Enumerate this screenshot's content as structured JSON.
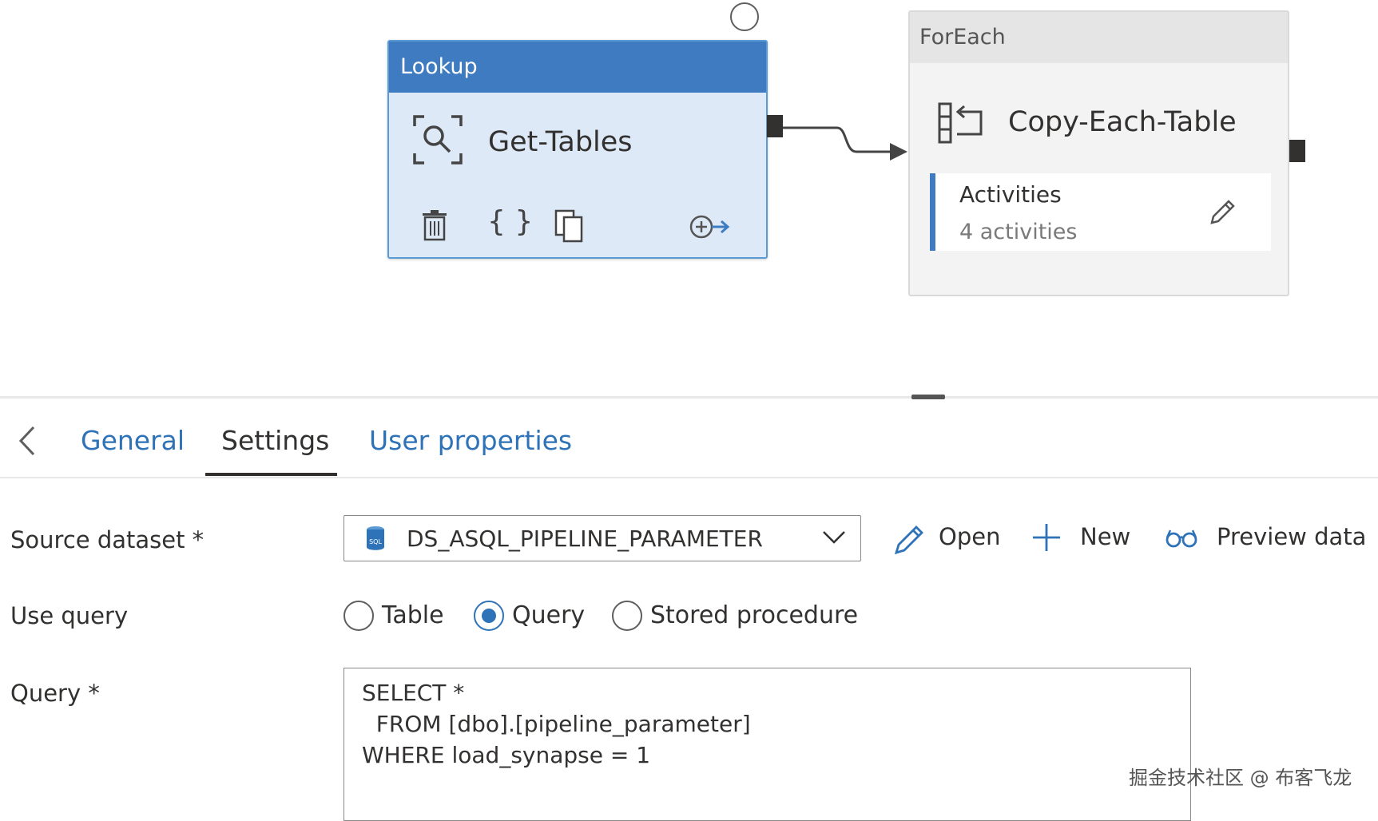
{
  "canvas": {
    "lookup": {
      "type_label": "Lookup",
      "name": "Get-Tables"
    },
    "foreach": {
      "type_label": "ForEach",
      "name": "Copy-Each-Table",
      "activities_label": "Activities",
      "activities_count": "4 activities"
    }
  },
  "tabs": [
    {
      "label": "General"
    },
    {
      "label": "Settings"
    },
    {
      "label": "User properties"
    }
  ],
  "active_tab": "Settings",
  "settings": {
    "source_dataset_label": "Source dataset *",
    "source_dataset_value": "DS_ASQL_PIPELINE_PARAMETER",
    "open_label": "Open",
    "new_label": "New",
    "preview_label": "Preview data",
    "use_query_label": "Use query",
    "use_query_options": [
      "Table",
      "Query",
      "Stored procedure"
    ],
    "use_query_selected": "Query",
    "query_label": "Query *",
    "query_lines": [
      "SELECT *",
      "  FROM [dbo].[pipeline_parameter]",
      "WHERE load_synapse = 1"
    ]
  },
  "watermark": "掘金技术社区 @ 布客飞龙",
  "colors": {
    "accent": "#3e7bc0",
    "link": "#2e72b8",
    "lookup_body": "#dde9f6"
  }
}
